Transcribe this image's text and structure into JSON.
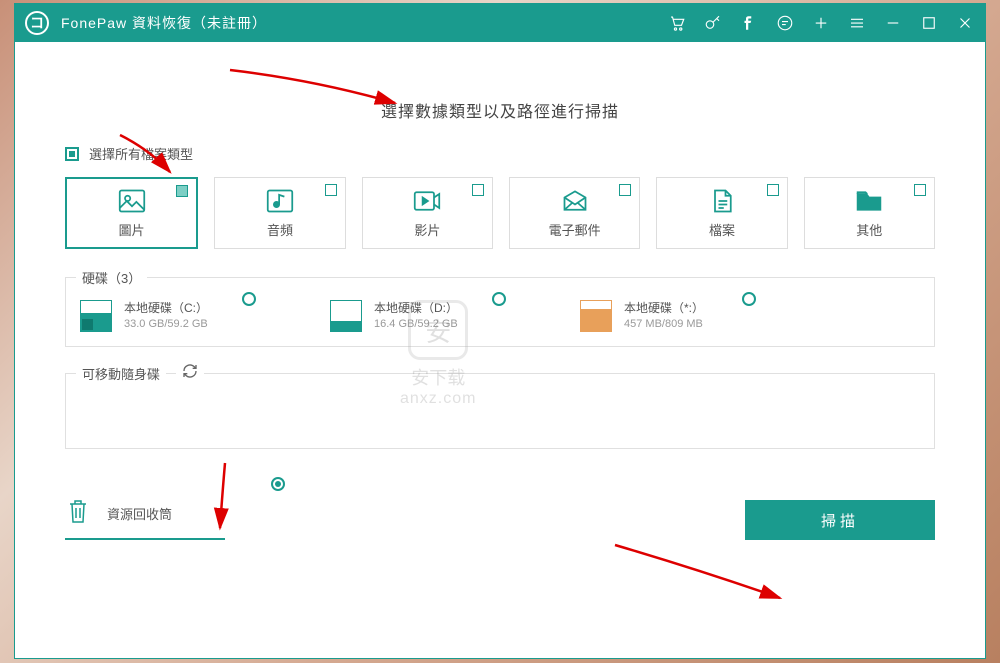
{
  "titlebar": {
    "app_name": "FonePaw 資料恢復（未註冊）",
    "logo_letter": "コ"
  },
  "heading": "選擇數據類型以及路徑進行掃描",
  "select_all_label": "選擇所有檔案類型",
  "types": [
    {
      "label": "圖片",
      "checked": true
    },
    {
      "label": "音頻",
      "checked": false
    },
    {
      "label": "影片",
      "checked": false
    },
    {
      "label": "電子郵件",
      "checked": false
    },
    {
      "label": "檔案",
      "checked": false
    },
    {
      "label": "其他",
      "checked": false
    }
  ],
  "disk_section": {
    "title": "硬碟（3）",
    "disks": [
      {
        "name": "本地硬碟（C:）",
        "size": "33.0 GB/59.2 GB"
      },
      {
        "name": "本地硬碟（D:）",
        "size": "16.4 GB/59.2 GB"
      },
      {
        "name": "本地硬碟（*:）",
        "size": "457 MB/809 MB"
      }
    ]
  },
  "removable_section": {
    "title": "可移動隨身碟"
  },
  "recycle": {
    "label": "資源回收筒",
    "selected": true
  },
  "scan_button": "掃描",
  "watermark": {
    "line1": "安下载",
    "line2": "anxz.com",
    "icon_text": "安"
  }
}
